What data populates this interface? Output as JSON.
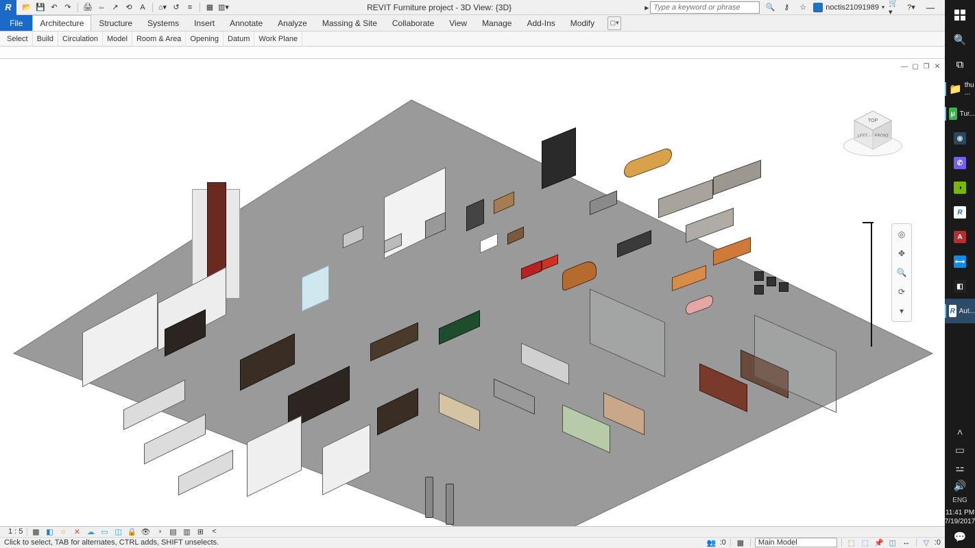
{
  "window": {
    "title": "REVIT Furniture project - 3D View: {3D}",
    "search_placeholder": "Type a keyword or phrase",
    "username": "noctis21091989"
  },
  "qat": [
    "open",
    "save",
    "undo",
    "redo",
    "print",
    "measure",
    "dim",
    "pin",
    "text",
    "3d",
    "sync",
    "switch",
    "thin",
    "close-hidden",
    "dropdown"
  ],
  "ribbon": {
    "file": "File",
    "tabs": [
      "Architecture",
      "Structure",
      "Systems",
      "Insert",
      "Annotate",
      "Analyze",
      "Massing & Site",
      "Collaborate",
      "View",
      "Manage",
      "Add-Ins",
      "Modify"
    ],
    "active_tab": "Architecture",
    "panels": [
      "Select",
      "Build",
      "Circulation",
      "Model",
      "Room & Area",
      "Opening",
      "Datum",
      "Work Plane"
    ]
  },
  "viewcube": {
    "top": "TOP",
    "front": "FRONT",
    "left": "LEFT"
  },
  "status": {
    "scale": "1 : 5",
    "zero": ":0",
    "model": "Main Model",
    "hint": "Click to select, TAB for alternates, CTRL adds, SHIFT unselects."
  },
  "taskbar": {
    "folder_label": "thu ...",
    "tur_label": "Tur...",
    "aut_label": "Aut...",
    "lang": "ENG",
    "time": "11:41 PM",
    "date": "7/19/2017"
  }
}
